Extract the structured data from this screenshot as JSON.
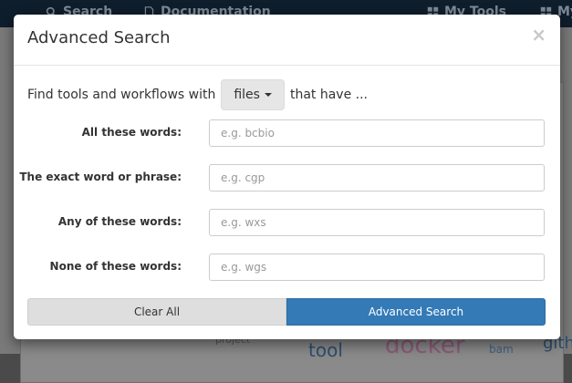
{
  "navbar": {
    "search_label": "Search",
    "documentation_label": "Documentation",
    "my_tools_label": "My Tools",
    "my_partial_label": "My"
  },
  "background": {
    "words": [
      "project",
      "tool",
      "docker",
      "bam",
      "gith"
    ]
  },
  "modal": {
    "title": "Advanced Search",
    "close_symbol": "×",
    "find_prefix": "Find tools and workflows with",
    "files_option": "files",
    "find_suffix": "that have ...",
    "fields": [
      {
        "label": "All these words:",
        "placeholder": "e.g. bcbio",
        "value": ""
      },
      {
        "label": "The exact word or phrase:",
        "placeholder": "e.g. cgp",
        "value": ""
      },
      {
        "label": "Any of these words:",
        "placeholder": "e.g. wxs",
        "value": ""
      },
      {
        "label": "None of these words:",
        "placeholder": "e.g. wgs",
        "value": ""
      }
    ],
    "clear_button": "Clear All",
    "search_button": "Advanced Search"
  },
  "colors": {
    "primary": "#337ab7",
    "navbar": "#0f1e2c",
    "clear_button": "#dedede"
  }
}
